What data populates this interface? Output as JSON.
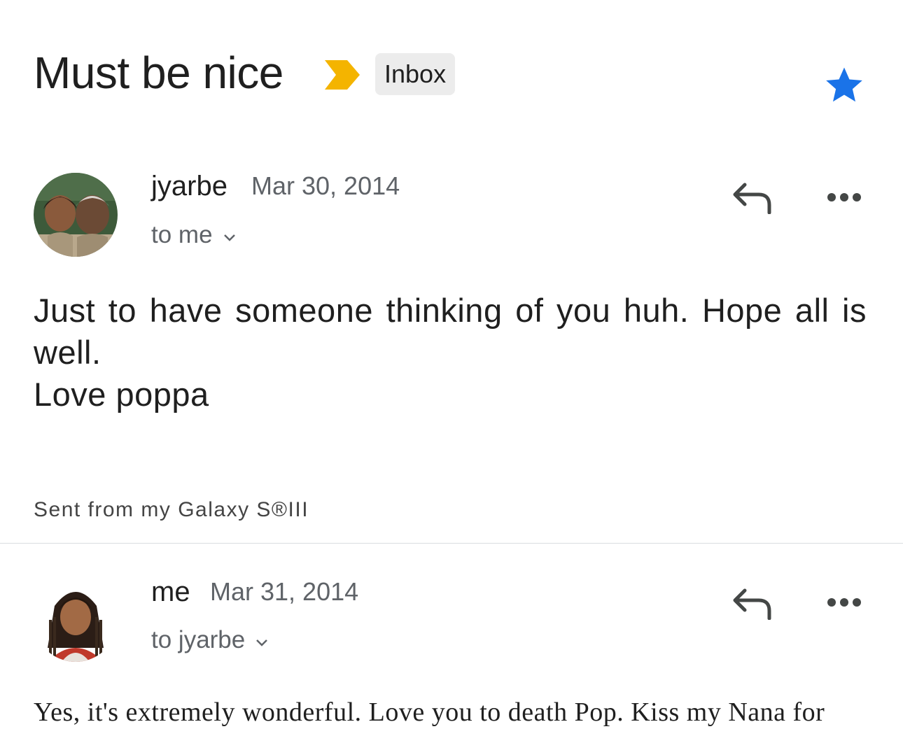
{
  "thread": {
    "subject": "Must be nice",
    "label": "Inbox",
    "colors": {
      "importance": "#F4B400",
      "star": "#1A73E8"
    }
  },
  "messages": [
    {
      "sender": "jyarbe",
      "date": "Mar 30, 2014",
      "recipients": "to me",
      "body_lines": [
        "Just to have someone thinking of you huh. Hope all is well.",
        "Love poppa"
      ],
      "signature": "Sent from my Galaxy S®III"
    },
    {
      "sender": "me",
      "date": "Mar 31, 2014",
      "recipients": "to jyarbe",
      "body_preview": "Yes, it's extremely wonderful.  Love you to death Pop.  Kiss my Nana for"
    }
  ],
  "icons": [
    "importance-marker-icon",
    "star-icon",
    "reply-icon",
    "more-options-icon",
    "chevron-down-icon"
  ]
}
